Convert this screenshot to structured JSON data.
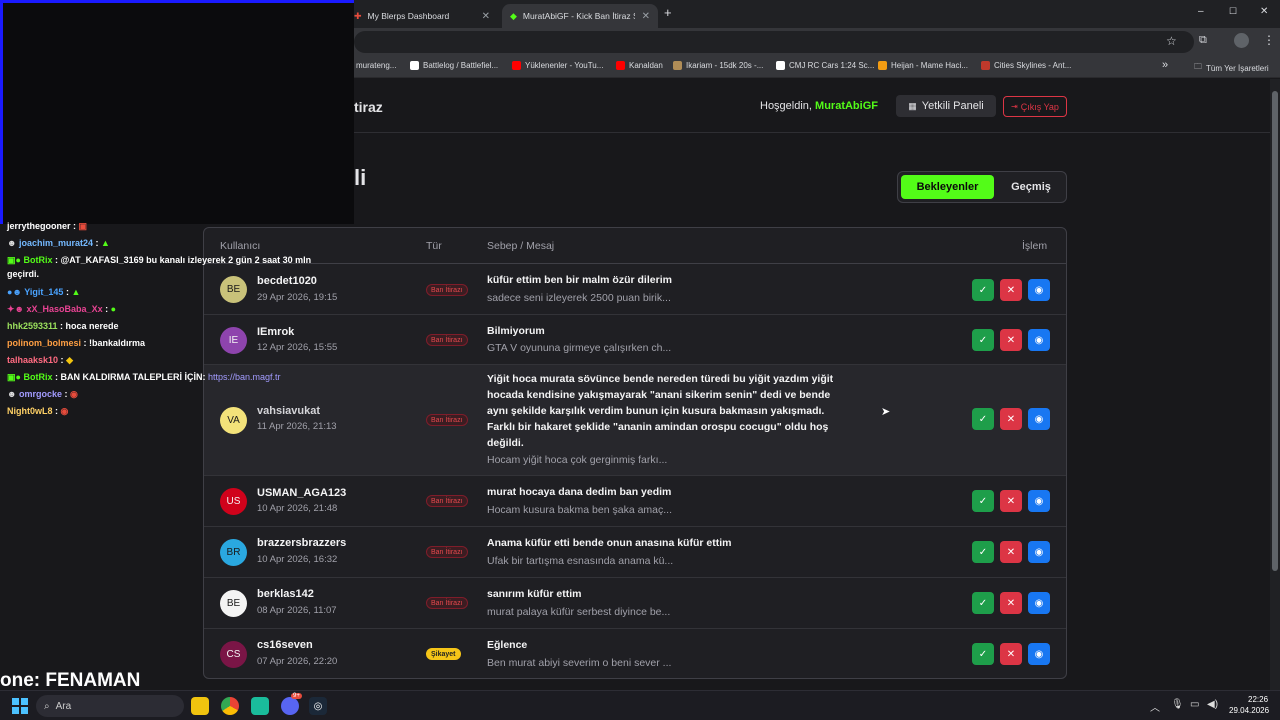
{
  "browser": {
    "tabs": [
      {
        "title": "My Blerps Dashboard"
      },
      {
        "title": "MuratAbiGF - Kick Ban İtiraz Sis"
      }
    ],
    "new_tab": "+",
    "window_controls": [
      "–",
      "☐",
      "✕"
    ],
    "bookmarks": [
      {
        "label": "murateng...",
        "color": "#2d2d2d"
      },
      {
        "label": "Battlelog / Battlefiel...",
        "color": "#ffffff"
      },
      {
        "label": "Yüklenenler - YouTu...",
        "color": "#ff0000"
      },
      {
        "label": "Kanaldan",
        "color": "#ff0000"
      },
      {
        "label": "Ikariam - 15dk 20s -...",
        "color": "#b08d57"
      },
      {
        "label": "CMJ RC Cars 1:24 Sc...",
        "color": "#ffffff"
      },
      {
        "label": "Heijan - Mame Haci...",
        "color": "#f39c12"
      },
      {
        "label": "Cities Skylines - Ant...",
        "color": "#c0392b"
      }
    ],
    "bookmarks_overflow": "»",
    "all_bookmarks": "Tüm Yer İşaretleri"
  },
  "site": {
    "title_fragment": "tiraz",
    "heading_fragment": "li",
    "welcome_prefix": "Hoşgeldin,",
    "username": "MuratAbiGF",
    "panel_button": "Yetkili Paneli",
    "logout_button": "Çıkış Yap",
    "filters": {
      "active": "Bekleyenler",
      "other": "Geçmiş"
    }
  },
  "table": {
    "headers": {
      "user": "Kullanıcı",
      "type": "Tür",
      "reason": "Sebep / Mesaj",
      "action": "İşlem"
    },
    "rows": [
      {
        "initials": "BE",
        "avatar_color": "#c9c27a",
        "username": "becdet1020",
        "date": "29 Apr 2026, 19:15",
        "type": "Ban İtirazı",
        "subject": "küfür ettim ben bir malm özür dilerim",
        "message": "sadece seni izleyerek 2500 puan birik..."
      },
      {
        "initials": "IE",
        "avatar_color": "#8e44ad",
        "username": "IEmrok",
        "date": "12 Apr 2026, 15:55",
        "type": "Ban İtirazı",
        "subject": "Bilmiyorum",
        "message": "GTA V oyununa girmeye çalışırken ch..."
      },
      {
        "initials": "VA",
        "avatar_color": "#f3e27a",
        "username": "vahsiavukat",
        "date": "11 Apr 2026, 21:13",
        "type": "Ban İtirazı",
        "subject": "Yiğit hoca murata sövünce bende nereden türedi bu yiğit yazdım yiğit hocada kendisine yakışmayarak \"anani sikerim senin\" dedi ve bende aynı şekilde karşılık verdim bunun için kusura bakmasın yakışmadı. Farklı bir hakaret şeklide \"ananin amindan orospu cocugu\" oldu hoş değildi.",
        "message": "Hocam yiğit hoca çok gerginmiş farkı..."
      },
      {
        "initials": "US",
        "avatar_color": "#d0021b",
        "username": "USMAN_AGA123",
        "date": "10 Apr 2026, 21:48",
        "type": "Ban İtirazı",
        "subject": "murat hocaya dana dedim ban yedim",
        "message": "Hocam kusura bakma ben şaka amaç..."
      },
      {
        "initials": "BR",
        "avatar_color": "#2aa8e0",
        "username": "brazzersbrazzers",
        "date": "10 Apr 2026, 16:32",
        "type": "Ban İtirazı",
        "subject": "Anama küfür etti bende onun anasına küfür ettim",
        "message": "Ufak bir tartışma esnasında anama kü..."
      },
      {
        "initials": "BE",
        "avatar_color": "#f4f4f4",
        "username": "berklas142",
        "date": "08 Apr 2026, 11:07",
        "type": "Ban İtirazı",
        "subject": "sanırım küfür ettim",
        "message": "murat palaya küfür serbest diyince be..."
      },
      {
        "initials": "CS",
        "avatar_color": "#7a1546",
        "username": "cs16seven",
        "date": "07 Apr 2026, 22:20",
        "type": "Şikayet",
        "subject": "Eğlence",
        "message": "Ben murat abiyi severim o beni sever ..."
      }
    ]
  },
  "overlay": {
    "chat": [
      {
        "name": "jerrythegooner",
        "color": "#ffffff",
        "text": " :"
      },
      {
        "name": "joachim_murat24",
        "color": "#74b9ff",
        "text": " :"
      },
      {
        "name": "BotRix",
        "color": "#53fc18",
        "text": " : @AT_KAFASI_3169 bu kanalı izleyerek 2 gün 2 saat 30 mln"
      },
      {
        "name": "",
        "color": "#ffffff",
        "text": "geçirdi."
      },
      {
        "name": "Yigit_145",
        "color": "#4aa3ff",
        "text": " :"
      },
      {
        "name": "xX_HasoBaba_Xx",
        "color": "#e84393",
        "text": " :"
      },
      {
        "name": "hhk2593311",
        "color": "#9be15d",
        "text": " : hoca nerede"
      },
      {
        "name": "polinom_bolmesi",
        "color": "#ff9f43",
        "text": " : !bankaldırma"
      },
      {
        "name": "talhaaksk10",
        "color": "#ff6b81",
        "text": " :"
      },
      {
        "name": "BotRix",
        "color": "#53fc18",
        "text": " : BAN KALDIRMA TALEPLERİ İÇİN: ",
        "link": "https://ban.magf.tr"
      },
      {
        "name": "omrgocke",
        "color": "#a29bfe",
        "text": " :"
      },
      {
        "name": "Night0wL8",
        "color": "#ffd166",
        "text": " :"
      }
    ],
    "bottom_text": "one: FENAMAN"
  },
  "taskbar": {
    "search_placeholder": "Ara",
    "time": "22:26",
    "date": "29.04.2026",
    "discord_badge": "9+"
  }
}
